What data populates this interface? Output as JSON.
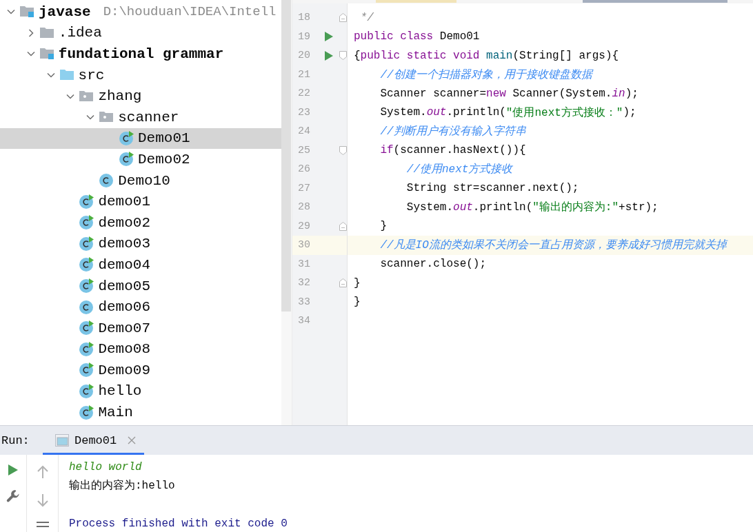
{
  "project_tree": {
    "items": [
      {
        "label": "javase",
        "kind": "module",
        "path": "D:\\houduan\\IDEA\\Intell",
        "expanded": true,
        "selected": false,
        "children": [
          {
            "label": ".idea",
            "kind": "folder",
            "expanded": false,
            "selected": false
          },
          {
            "label": "fundational grammar",
            "kind": "module",
            "expanded": true,
            "selected": false,
            "children": [
              {
                "label": "src",
                "kind": "source-folder",
                "expanded": true,
                "selected": false,
                "children": [
                  {
                    "label": "zhang",
                    "kind": "package",
                    "expanded": true,
                    "selected": false,
                    "children": [
                      {
                        "label": "scanner",
                        "kind": "package",
                        "expanded": true,
                        "selected": false,
                        "children": [
                          {
                            "label": "Demo01",
                            "kind": "runnable-class",
                            "selected": true
                          },
                          {
                            "label": "Demo02",
                            "kind": "runnable-class",
                            "selected": false
                          }
                        ]
                      },
                      {
                        "label": "Demo10",
                        "kind": "class",
                        "selected": false
                      }
                    ]
                  },
                  {
                    "label": "demo01",
                    "kind": "runnable-class",
                    "selected": false
                  },
                  {
                    "label": "demo02",
                    "kind": "runnable-class",
                    "selected": false
                  },
                  {
                    "label": "demo03",
                    "kind": "runnable-class",
                    "selected": false
                  },
                  {
                    "label": "demo04",
                    "kind": "runnable-class",
                    "selected": false
                  },
                  {
                    "label": "demo05",
                    "kind": "runnable-class",
                    "selected": false
                  },
                  {
                    "label": "demo06",
                    "kind": "class",
                    "selected": false
                  },
                  {
                    "label": "Demo07",
                    "kind": "runnable-class",
                    "selected": false
                  },
                  {
                    "label": "Demo08",
                    "kind": "runnable-class",
                    "selected": false
                  },
                  {
                    "label": "Demo09",
                    "kind": "runnable-class",
                    "selected": false
                  },
                  {
                    "label": "hello",
                    "kind": "runnable-class",
                    "selected": false
                  },
                  {
                    "label": "Main",
                    "kind": "runnable-class",
                    "selected": false
                  }
                ]
              }
            ]
          }
        ]
      }
    ]
  },
  "editor": {
    "lines": [
      {
        "number": "18",
        "markers": [
          {
            "kind": "fold-end"
          }
        ],
        "current": false,
        "tokens": [
          {
            "text": " */",
            "kind": "doc-comment"
          }
        ]
      },
      {
        "number": "19",
        "markers": [
          {
            "kind": "run"
          }
        ],
        "current": false,
        "tokens": [
          {
            "text": "public class ",
            "kind": "keyword"
          },
          {
            "text": "Demo01",
            "kind": "plain"
          }
        ]
      },
      {
        "number": "20",
        "markers": [
          {
            "kind": "run"
          },
          {
            "kind": "fold-start"
          }
        ],
        "current": false,
        "tokens": [
          {
            "text": "{",
            "kind": "plain"
          },
          {
            "text": "public static void ",
            "kind": "keyword"
          },
          {
            "text": "main",
            "kind": "method"
          },
          {
            "text": "(String[] args){",
            "kind": "plain"
          }
        ]
      },
      {
        "number": "21",
        "current": false,
        "tokens": [
          {
            "text": "    //创建一个扫描器对象，用于接收键盘数据",
            "kind": "comment"
          }
        ]
      },
      {
        "number": "22",
        "current": false,
        "tokens": [
          {
            "text": "    Scanner scanner=",
            "kind": "plain"
          },
          {
            "text": "new ",
            "kind": "keyword"
          },
          {
            "text": "Scanner(System.",
            "kind": "plain"
          },
          {
            "text": "in",
            "kind": "static-field"
          },
          {
            "text": ");",
            "kind": "plain"
          }
        ]
      },
      {
        "number": "23",
        "current": false,
        "tokens": [
          {
            "text": "    System.",
            "kind": "plain"
          },
          {
            "text": "out",
            "kind": "static-field"
          },
          {
            "text": ".println(",
            "kind": "plain"
          },
          {
            "text": "\"使用next方式接收：\"",
            "kind": "string"
          },
          {
            "text": ");",
            "kind": "plain"
          }
        ]
      },
      {
        "number": "24",
        "current": false,
        "tokens": [
          {
            "text": "    //判断用户有没有输入字符串",
            "kind": "comment"
          }
        ]
      },
      {
        "number": "25",
        "markers": [
          {
            "kind": "fold-start"
          }
        ],
        "current": false,
        "tokens": [
          {
            "text": "    if",
            "kind": "keyword"
          },
          {
            "text": "(scanner.hasNext()){",
            "kind": "plain"
          }
        ]
      },
      {
        "number": "26",
        "current": false,
        "tokens": [
          {
            "text": "        //使用next方式接收",
            "kind": "comment"
          }
        ]
      },
      {
        "number": "27",
        "current": false,
        "tokens": [
          {
            "text": "        String str=scanner.next();",
            "kind": "plain"
          }
        ]
      },
      {
        "number": "28",
        "current": false,
        "tokens": [
          {
            "text": "        System.",
            "kind": "plain"
          },
          {
            "text": "out",
            "kind": "static-field"
          },
          {
            "text": ".println(",
            "kind": "plain"
          },
          {
            "text": "\"输出的内容为:\"",
            "kind": "string"
          },
          {
            "text": "+str);",
            "kind": "plain"
          }
        ]
      },
      {
        "number": "29",
        "markers": [
          {
            "kind": "fold-end"
          }
        ],
        "current": false,
        "tokens": [
          {
            "text": "    }",
            "kind": "plain"
          }
        ]
      },
      {
        "number": "30",
        "current": true,
        "tokens": [
          {
            "text": "    //凡是IO流的类如果不关闭会一直占用资源，要养成好习惯用完就关掉",
            "kind": "comment"
          }
        ]
      },
      {
        "number": "31",
        "current": false,
        "tokens": [
          {
            "text": "    scanner.close();",
            "kind": "plain"
          }
        ]
      },
      {
        "number": "32",
        "markers": [
          {
            "kind": "fold-end"
          }
        ],
        "current": false,
        "tokens": [
          {
            "text": "}",
            "kind": "plain"
          }
        ]
      },
      {
        "number": "33",
        "current": false,
        "tokens": [
          {
            "text": "}",
            "kind": "plain"
          }
        ]
      },
      {
        "number": "34",
        "current": false
      }
    ]
  },
  "run_panel": {
    "title": "Run:",
    "tabs": [
      {
        "label": "Demo01",
        "selected": true
      }
    ],
    "console": [
      {
        "kind": "input",
        "text": "hello world"
      },
      {
        "kind": "output",
        "text": "输出的内容为:hello"
      },
      {
        "kind": "blank"
      },
      {
        "kind": "system",
        "text": "Process finished with exit code 0"
      }
    ]
  }
}
